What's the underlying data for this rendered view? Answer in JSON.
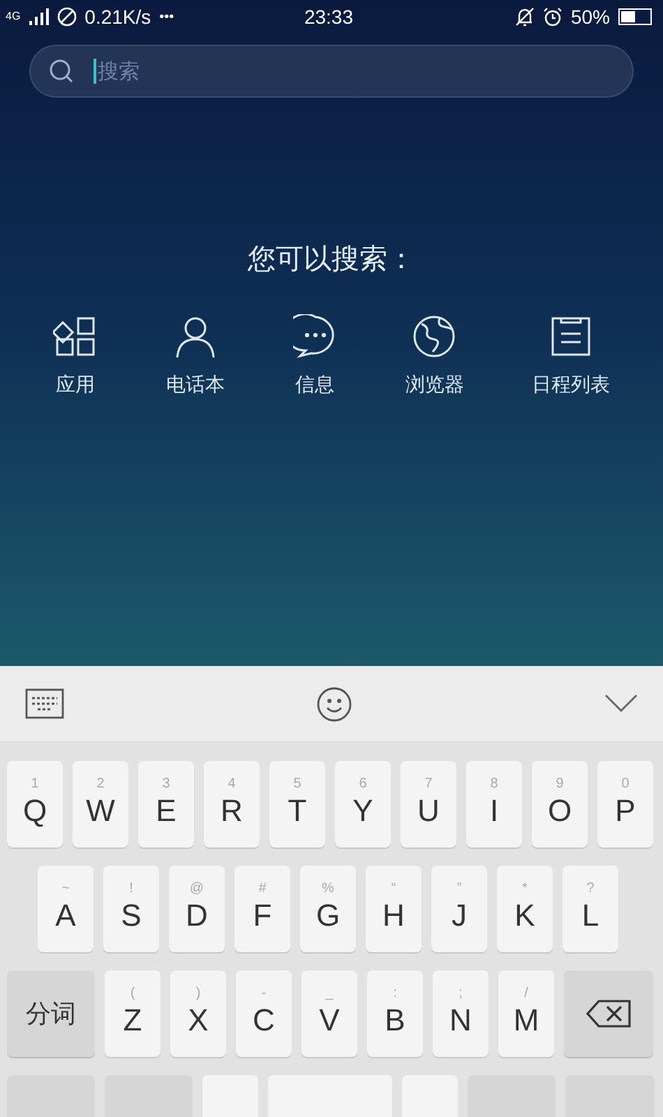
{
  "status_bar": {
    "network": "4G",
    "speed": "0.21K/s",
    "more": "•••",
    "time": "23:33",
    "battery": "50%"
  },
  "search": {
    "placeholder": "搜索"
  },
  "prompt": "您可以搜索：",
  "categories": [
    {
      "label": "应用",
      "kind": "apps"
    },
    {
      "label": "电话本",
      "kind": "contacts"
    },
    {
      "label": "信息",
      "kind": "messages"
    },
    {
      "label": "浏览器",
      "kind": "browser"
    },
    {
      "label": "日程列表",
      "kind": "schedule"
    }
  ],
  "keyboard": {
    "rows": [
      [
        {
          "kind": "letter",
          "label": "Q",
          "hint": "1"
        },
        {
          "kind": "letter",
          "label": "W",
          "hint": "2"
        },
        {
          "kind": "letter",
          "label": "E",
          "hint": "3"
        },
        {
          "kind": "letter",
          "label": "R",
          "hint": "4"
        },
        {
          "kind": "letter",
          "label": "T",
          "hint": "5"
        },
        {
          "kind": "letter",
          "label": "Y",
          "hint": "6"
        },
        {
          "kind": "letter",
          "label": "U",
          "hint": "7"
        },
        {
          "kind": "letter",
          "label": "I",
          "hint": "8"
        },
        {
          "kind": "letter",
          "label": "O",
          "hint": "9"
        },
        {
          "kind": "letter",
          "label": "P",
          "hint": "0"
        }
      ],
      [
        {
          "kind": "letter",
          "label": "A",
          "hint": "~"
        },
        {
          "kind": "letter",
          "label": "S",
          "hint": "!"
        },
        {
          "kind": "letter",
          "label": "D",
          "hint": "@"
        },
        {
          "kind": "letter",
          "label": "F",
          "hint": "#"
        },
        {
          "kind": "letter",
          "label": "G",
          "hint": "%"
        },
        {
          "kind": "letter",
          "label": "H",
          "hint": "“"
        },
        {
          "kind": "letter",
          "label": "J",
          "hint": "”"
        },
        {
          "kind": "letter",
          "label": "K",
          "hint": "*"
        },
        {
          "kind": "letter",
          "label": "L",
          "hint": "?"
        }
      ],
      [
        {
          "kind": "function",
          "label": "分词"
        },
        {
          "kind": "letter",
          "label": "Z",
          "hint": "("
        },
        {
          "kind": "letter",
          "label": "X",
          "hint": ")"
        },
        {
          "kind": "letter",
          "label": "C",
          "hint": "-"
        },
        {
          "kind": "letter",
          "label": "V",
          "hint": "_"
        },
        {
          "kind": "letter",
          "label": "B",
          "hint": ":"
        },
        {
          "kind": "letter",
          "label": "N",
          "hint": ";"
        },
        {
          "kind": "letter",
          "label": "M",
          "hint": "/"
        },
        {
          "kind": "backspace"
        }
      ]
    ]
  }
}
